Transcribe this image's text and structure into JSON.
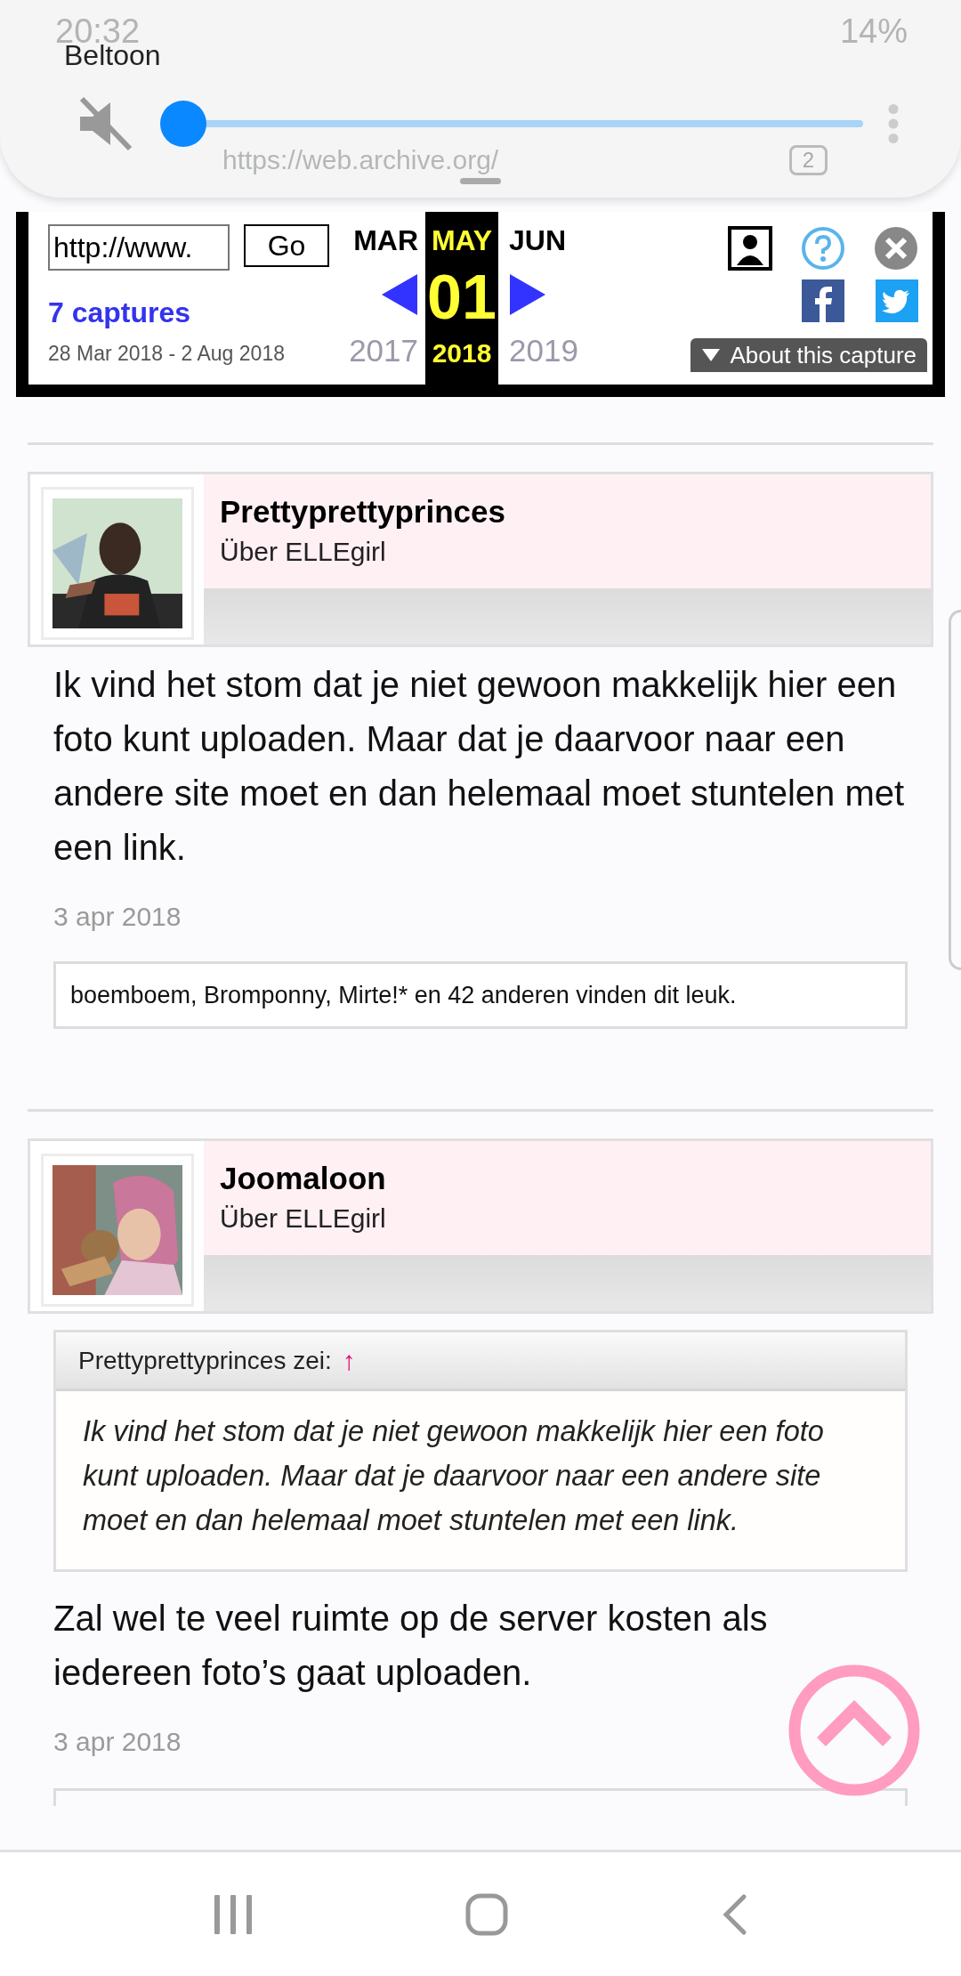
{
  "status_bar": {
    "time": "20:32",
    "battery": "14%"
  },
  "volume_panel": {
    "label": "Beltoon",
    "muted": true,
    "level": 0
  },
  "browser": {
    "url": "https://web.archive.org/",
    "tab_count": "2"
  },
  "wayback": {
    "url_field": "http://www.",
    "go": "Go",
    "captures": "7 captures",
    "range": "28 Mar 2018 - 2 Aug 2018",
    "about": "About this capture",
    "months": [
      {
        "month": "MAR",
        "year": "2017",
        "selected": false
      },
      {
        "month": "MAY",
        "day": "01",
        "year": "2018",
        "selected": true
      },
      {
        "month": "JUN",
        "year": "2019",
        "selected": false
      }
    ]
  },
  "posts": [
    {
      "author": "Prettyprettyprinces",
      "subtitle": "Über ELLEgirl",
      "body": "Ik vind het stom dat je niet gewoon makkelijk hier een foto kunt uploaden. Maar dat je daarvoor naar een andere site moet en dan helemaal moet stuntelen met een link.",
      "date": "3 apr 2018",
      "likes": "boemboem, Bromponny, Mirte!* en 42 anderen vinden dit leuk."
    },
    {
      "author": "Joomaloon",
      "subtitle": "Über ELLEgirl",
      "quote": {
        "header": "Prettyprettyprinces zei:",
        "arrow": "↑",
        "text": "Ik vind het stom dat je niet gewoon makkelijk hier een foto kunt uploaden. Maar dat je daarvoor naar een andere site moet en dan helemaal moet stuntelen met een link."
      },
      "body": "Zal wel te veel ruimte op de server kosten als iedereen foto’s gaat uploaden.",
      "date": "3 apr 2018"
    }
  ]
}
